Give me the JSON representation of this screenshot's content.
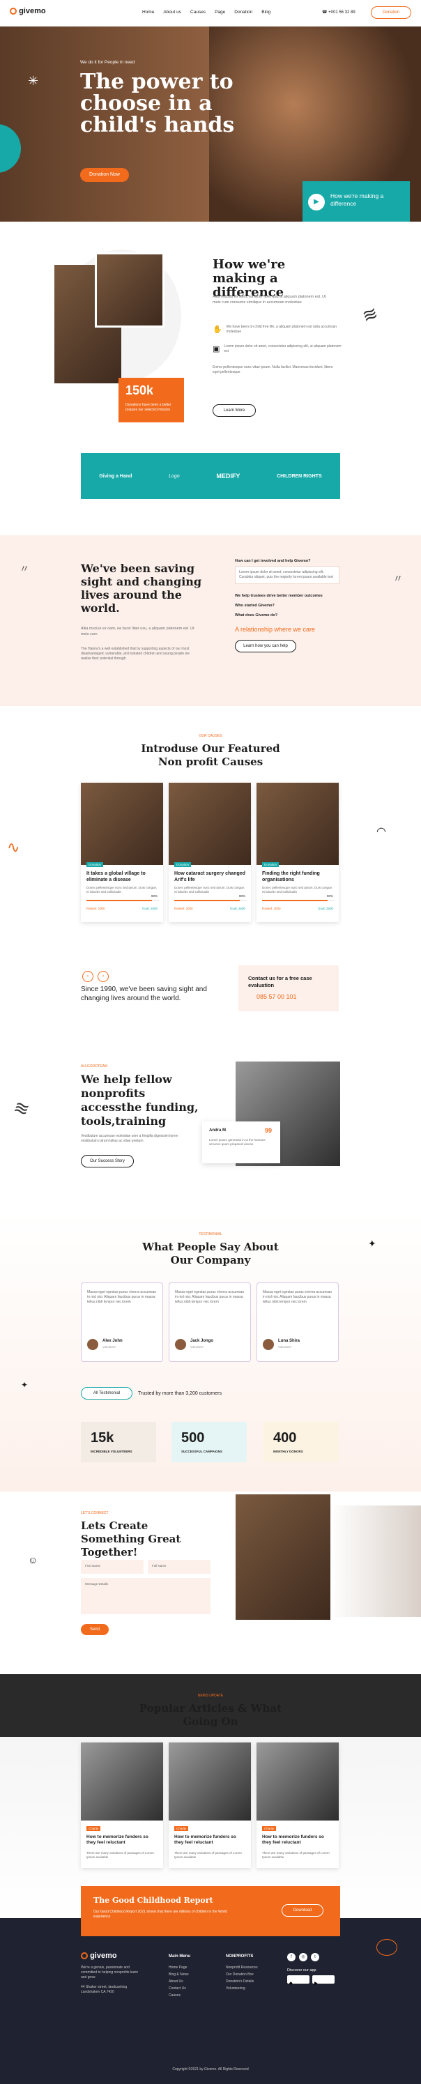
{
  "header": {
    "logo": "givemo",
    "nav": [
      "Home",
      "About us",
      "Causes",
      "Page",
      "Donation",
      "Blog"
    ],
    "phone": "+001 56 32 89",
    "cta": "Donation"
  },
  "hero": {
    "kicker": "We do it for People in need",
    "title": "The power to choose in a child's hands",
    "button": "Donation Now",
    "video_caption": "How we're making a difference"
  },
  "about": {
    "title": "How we're making a difference",
    "text": "Aliia mucius ex nam, ea facer liber usu, a aliquam platonem est. Ut meis cum consume similique in accumsan molestiae",
    "feature1": "We have been on child free life, a aliquam platonem est ratia accumsan molestiae",
    "feature2": "Lorem ipsum dolor sit amet, consectetur adipiscing elit, ut aliquam platonem est",
    "text2": "Enims pellentesque nunc vitae ipsum. Nulla facilisi. Maecenas tincidunt, libero eget pellentesque",
    "button": "Learn More",
    "stat": "150k",
    "stat_label": "Donations have been a better prepare our selected mission"
  },
  "partners": [
    "Giving a Hand",
    "Logo",
    "MEDIFY",
    "CHILDREN RIGHTS"
  ],
  "sight": {
    "title": "We've been saving sight and changing lives around the world.",
    "text1": "Aliia mucius ex nam, ea facer liber usu, a aliquam platonem est. Ut meis cum",
    "text2": "The Hanna's a well established that by supporting aspects of our most disadvantaged, vulnerable, and isolated children and young people we realise their potential through",
    "faq": [
      "How can I get involved and help Givemo?",
      "We help trustees drive better member outcomes",
      "Who started Givemo?",
      "What does Givemo do?"
    ],
    "faq_answer": "Lorem ipsum dolor sit amet, consectetur adipiscing elit. Curabitur aliquet, quis the majority lorem ipsum available text",
    "link": "A relationship where we care",
    "button": "Learn how you can help"
  },
  "causes": {
    "kicker": "OUR CAUSES",
    "title": "Introduse Our Featured Non profit Causes",
    "items": [
      {
        "tag": "Donation",
        "title": "It takes a global village to eliminate a disease",
        "text": "Donec pellentesque nunc sed ipsum. Duis congue, et lobortis sed sollicitudin",
        "pct": "90%",
        "raised": "Raised: 2000",
        "goal": "Goal: 2500"
      },
      {
        "tag": "Donation",
        "title": "How cataract surgery changed Arif's life",
        "text": "Donec pellentesque nunc sed ipsum. Duis congue, et lobortis sed sollicitudin",
        "pct": "90%",
        "raised": "Raised: 2000",
        "goal": "Goal: 2500"
      },
      {
        "tag": "Donation",
        "title": "Finding the right funding organisations",
        "text": "Donec pellentesque nunc sed ipsum. Duis congue, et lobortis sed sollicitudin",
        "pct": "90%",
        "raised": "Raised: 2000",
        "goal": "Goal: 2500"
      }
    ],
    "since": "Since 1990, we've been saving sight and changing lives around the world.",
    "contact_label": "Contact us for a free case evaluation",
    "contact_phone": "085 57 00 101"
  },
  "help": {
    "kicker": "ALLGOODTEAM",
    "title": "We help fellow nonprofits accessthe funding, tools,training",
    "text": "Vestibulum accumsan molestiae sem a fringilla dignissim lorem vestibulum rutrum tellus ac vitae pretium",
    "button": "Our Success Story",
    "card_name": "Andra M",
    "card_value": "99",
    "card_text": "Lorem ipsum generetia in ut the humans services quam prepared visions"
  },
  "testimonials": {
    "kicker": "TESTIMONIAL",
    "title": "What People Say About Our Company",
    "items": [
      {
        "text": "Massa eget egestas purus viverra accumsan in nisl nisi. Aliquam faucibus purus in massa tellus nibh tempor nec lorem",
        "name": "Alex John",
        "role": "Volunteer"
      },
      {
        "text": "Massa eget egestas purus viverra accumsan in nisl nisi. Aliquam faucibus purus in massa tellus nibh tempor nec lorem",
        "name": "Jack Jongo",
        "role": "Volunteer"
      },
      {
        "text": "Massa eget egestas purus viverra accumsan in nisl nisi. Aliquam faucibus purus in massa tellus nibh tempor nec lorem",
        "name": "Luna Shira",
        "role": "Volunteer"
      }
    ],
    "all_button": "All Testimonial",
    "trusted": "Trusted by more than 3,200 customers"
  },
  "stats": [
    {
      "value": "15k",
      "label": "INCREDIBLE VOLUNTEERS"
    },
    {
      "value": "500",
      "label": "SUCCESSFUL CAMPAIGNS"
    },
    {
      "value": "400",
      "label": "MONTHLY DONORS"
    }
  ],
  "contact": {
    "kicker": "LET'S CONNECT",
    "title": "Lets Create Something Great Together!",
    "first_name": "First Name",
    "full_name": "Full Name",
    "message": "Message Details",
    "button": "Send"
  },
  "articles": {
    "kicker": "NEWS UPDATE",
    "title": "Popular Articles & What Going On",
    "items": [
      {
        "tag": "Charity",
        "title": "How to memorize funders so they feel reluctant",
        "text": "There are many variations of passages of Lorem Ipsum available"
      },
      {
        "tag": "Charity",
        "title": "How to memorize funders so they feel reluctant",
        "text": "There are many variations of passages of Lorem Ipsum available"
      },
      {
        "tag": "Charity",
        "title": "How to memorize funders so they feel reluctant",
        "text": "There are many variations of passages of Lorem Ipsum available"
      }
    ]
  },
  "report": {
    "title": "The Good Childhood Report",
    "text": "Our Good Childhood Report 2021 shows that there are millions of children in the World experience",
    "button": "Download"
  },
  "footer": {
    "logo": "givemo",
    "about": "We're a genius, passionate and committed to helping nonprofits learn and grow",
    "address": "44 Shaker street, landcashing Landshaken CA 7420",
    "col1_title": "Main Menu",
    "col1": [
      "Home Page",
      "Blog & News",
      "About Us",
      "Contact Us",
      "Causes"
    ],
    "col2_title": "NONPROFITS",
    "col2": [
      "Nonprofit Resources",
      "Our Donation Box",
      "Donation's Details",
      "Volunteering"
    ],
    "app_title": "Discover our app",
    "copyright": "Copyright ©2021 by Givemo. All Rights Reserved"
  },
  "colors": {
    "orange": "#f26a1b",
    "teal": "#16a9a8",
    "peach": "#fdf0ea",
    "dark": "#1f2230"
  }
}
